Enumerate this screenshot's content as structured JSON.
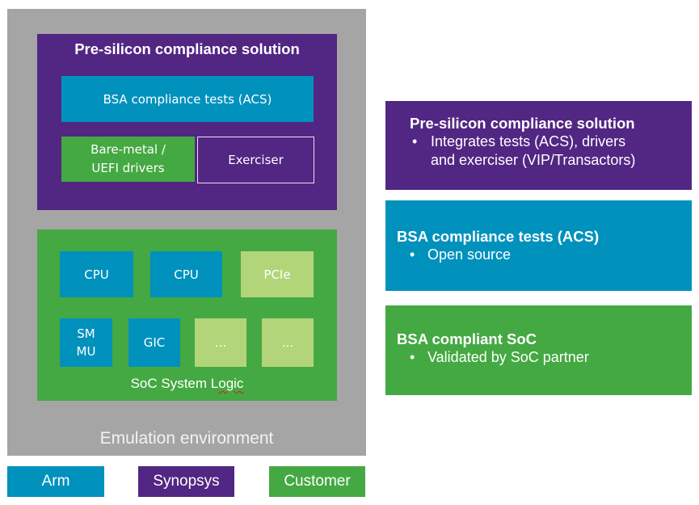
{
  "diagram": {
    "emulation": {
      "label": "Emulation environment",
      "presilicon": {
        "title": "Pre-silicon compliance solution",
        "acs": "BSA compliance tests (ACS)",
        "drivers": "Bare-metal / UEFI drivers",
        "drivers_line1": "Bare-metal /",
        "drivers_line2": "UEFI drivers",
        "exerciser": "Exerciser"
      },
      "soc": {
        "label_prefix": "SoC System L",
        "label_flagged": "ogic",
        "label": "SoC System Logic",
        "blocks": [
          {
            "label": "CPU",
            "owner": "Arm"
          },
          {
            "label": "CPU",
            "owner": "Arm"
          },
          {
            "label": "PCIe",
            "owner": "Customer"
          },
          {
            "label": "SMMU",
            "line1": "SM",
            "line2": "MU",
            "owner": "Arm"
          },
          {
            "label": "GIC",
            "owner": "Arm"
          },
          {
            "label": "...",
            "owner": "Customer"
          },
          {
            "label": "...",
            "owner": "Customer"
          }
        ]
      }
    },
    "legend": [
      {
        "label": "Arm",
        "color": "#0091bd"
      },
      {
        "label": "Synopsys",
        "color": "#522683"
      },
      {
        "label": "Customer",
        "color": "#44a942"
      }
    ],
    "cards": [
      {
        "title": "Pre-silicon compliance solution",
        "bullets": [
          "Integrates tests (ACS), drivers and exerciser (VIP/Transactors)"
        ],
        "line1": "Integrates tests (ACS), drivers",
        "line2": "and exerciser (VIP/Transactors)",
        "color": "#522683"
      },
      {
        "title": "BSA compliance tests (ACS)",
        "bullets": [
          "Open source"
        ],
        "color": "#0091bd"
      },
      {
        "title": "BSA compliant SoC",
        "bullets": [
          "Validated by SoC partner"
        ],
        "color": "#44a942"
      }
    ],
    "bullet_glyph": "•"
  }
}
